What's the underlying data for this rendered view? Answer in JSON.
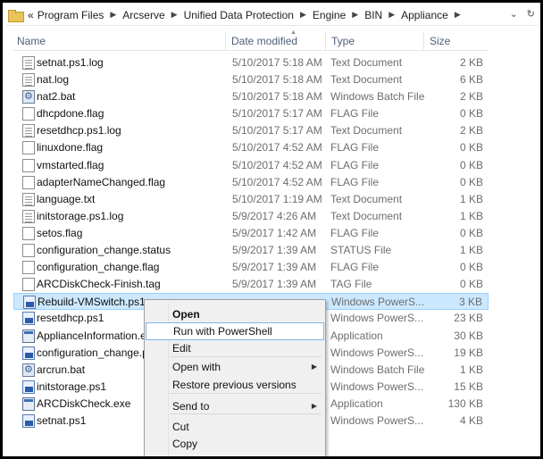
{
  "address_bar": {
    "prefix": "«",
    "crumbs": [
      "Program Files",
      "Arcserve",
      "Unified Data Protection",
      "Engine",
      "BIN",
      "Appliance"
    ],
    "dropdown_glyph": "⌄",
    "refresh_glyph": "↻"
  },
  "columns": {
    "name": "Name",
    "date": "Date modified",
    "type": "Type",
    "size": "Size"
  },
  "files": [
    {
      "name": "setnat.ps1.log",
      "date": "5/10/2017 5:18 AM",
      "type": "Text Document",
      "size": "2 KB",
      "icon": "text-document-icon"
    },
    {
      "name": "nat.log",
      "date": "5/10/2017 5:18 AM",
      "type": "Text Document",
      "size": "6 KB",
      "icon": "text-document-icon"
    },
    {
      "name": "nat2.bat",
      "date": "5/10/2017 5:18 AM",
      "type": "Windows Batch File",
      "size": "2 KB",
      "icon": "batch-file-icon"
    },
    {
      "name": "dhcpdone.flag",
      "date": "5/10/2017 5:17 AM",
      "type": "FLAG File",
      "size": "0 KB",
      "icon": "blank-file-icon"
    },
    {
      "name": "resetdhcp.ps1.log",
      "date": "5/10/2017 5:17 AM",
      "type": "Text Document",
      "size": "2 KB",
      "icon": "text-document-icon"
    },
    {
      "name": "linuxdone.flag",
      "date": "5/10/2017 4:52 AM",
      "type": "FLAG File",
      "size": "0 KB",
      "icon": "blank-file-icon"
    },
    {
      "name": "vmstarted.flag",
      "date": "5/10/2017 4:52 AM",
      "type": "FLAG File",
      "size": "0 KB",
      "icon": "blank-file-icon"
    },
    {
      "name": "adapterNameChanged.flag",
      "date": "5/10/2017 4:52 AM",
      "type": "FLAG File",
      "size": "0 KB",
      "icon": "blank-file-icon"
    },
    {
      "name": "language.txt",
      "date": "5/10/2017 1:19 AM",
      "type": "Text Document",
      "size": "1 KB",
      "icon": "text-document-icon"
    },
    {
      "name": "initstorage.ps1.log",
      "date": "5/9/2017 4:26 AM",
      "type": "Text Document",
      "size": "1 KB",
      "icon": "text-document-icon"
    },
    {
      "name": "setos.flag",
      "date": "5/9/2017 1:42 AM",
      "type": "FLAG File",
      "size": "0 KB",
      "icon": "blank-file-icon"
    },
    {
      "name": "configuration_change.status",
      "date": "5/9/2017 1:39 AM",
      "type": "STATUS File",
      "size": "1 KB",
      "icon": "blank-file-icon"
    },
    {
      "name": "configuration_change.flag",
      "date": "5/9/2017 1:39 AM",
      "type": "FLAG File",
      "size": "0 KB",
      "icon": "blank-file-icon"
    },
    {
      "name": "ARCDiskCheck-Finish.tag",
      "date": "5/9/2017 1:39 AM",
      "type": "TAG File",
      "size": "0 KB",
      "icon": "blank-file-icon"
    },
    {
      "name": "Rebuild-VMSwitch.ps1",
      "date": "",
      "type": "Windows PowerS...",
      "size": "3 KB",
      "icon": "powershell-script-icon",
      "selected": true
    },
    {
      "name": "resetdhcp.ps1",
      "date": "",
      "type": "Windows PowerS...",
      "size": "23 KB",
      "icon": "powershell-script-icon"
    },
    {
      "name": "ApplianceInformation.exe",
      "date": "",
      "type": "Application",
      "size": "30 KB",
      "icon": "application-icon"
    },
    {
      "name": "configuration_change.ps",
      "date": "",
      "type": "Windows PowerS...",
      "size": "19 KB",
      "icon": "powershell-script-icon"
    },
    {
      "name": "arcrun.bat",
      "date": "",
      "type": "Windows Batch File",
      "size": "1 KB",
      "icon": "batch-file-icon"
    },
    {
      "name": "initstorage.ps1",
      "date": "",
      "type": "Windows PowerS...",
      "size": "15 KB",
      "icon": "powershell-script-icon"
    },
    {
      "name": "ARCDiskCheck.exe",
      "date": "",
      "type": "Application",
      "size": "130 KB",
      "icon": "application-icon"
    },
    {
      "name": "setnat.ps1",
      "date": "",
      "type": "Windows PowerS...",
      "size": "4 KB",
      "icon": "powershell-script-icon"
    }
  ],
  "context_menu": {
    "items": [
      {
        "label": "Open",
        "bold": true
      },
      {
        "label": "Run with PowerShell",
        "highlighted": true
      },
      {
        "label": "Edit"
      },
      {
        "label": "Open with",
        "submenu": true
      },
      {
        "label": "Restore previous versions"
      },
      {
        "label": "Send to",
        "submenu": true
      },
      {
        "label": "Cut"
      },
      {
        "label": "Copy"
      }
    ],
    "submenu_glyph": "▶"
  }
}
